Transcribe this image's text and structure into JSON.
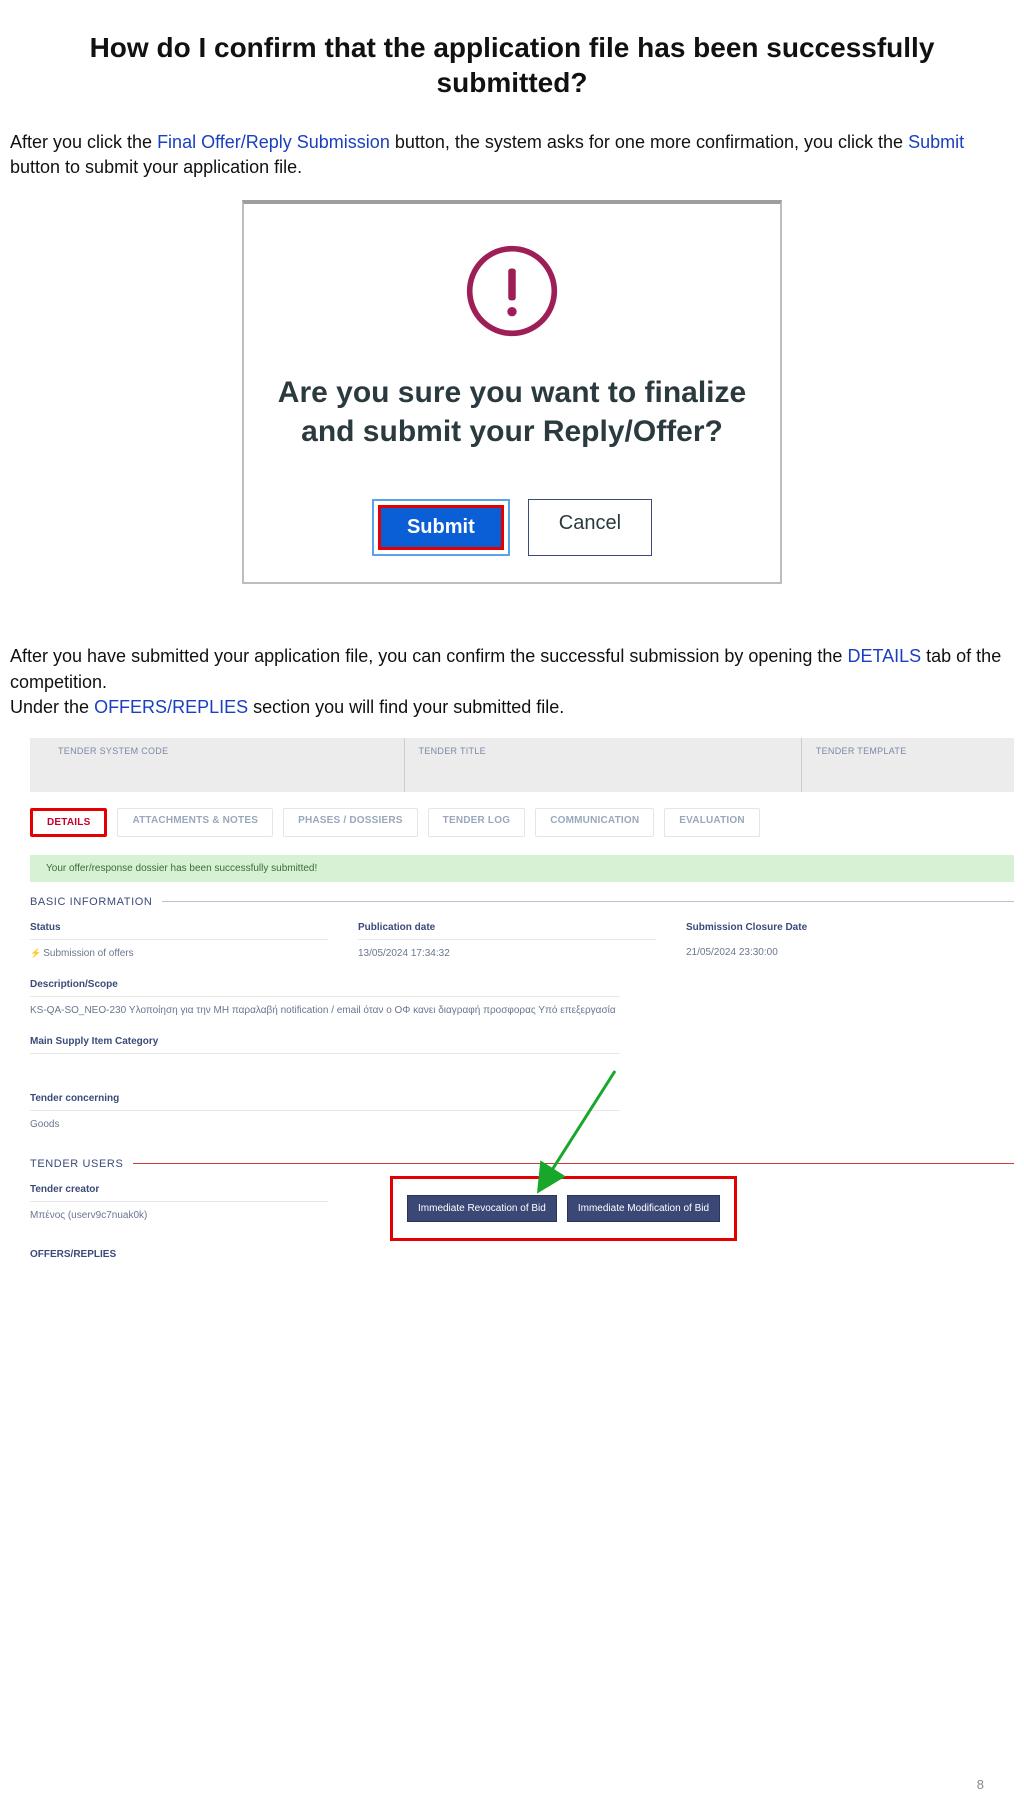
{
  "title": "How do I confirm that the application file has been successfully submitted?",
  "intro": {
    "t1": "After you click the ",
    "link1": "Final Offer/Reply Submission",
    "t2": " button, the system asks for one more confirmation, you click the ",
    "link2": "Submit",
    "t3": " button to submit your application file."
  },
  "modal": {
    "heading": "Are you sure you want to finalize and submit your Reply/Offer?",
    "submit": "Submit",
    "cancel": "Cancel"
  },
  "para2": {
    "t1": "After you have submitted your application file, you can confirm the successful submission by opening the ",
    "link1": "DETAILS",
    "t2": " tab of the competition.",
    "t3": "Under the ",
    "link2": "OFFERS/REPLIES",
    "t4": " section you will find your submitted file."
  },
  "header": {
    "c1": "TENDER SYSTEM CODE",
    "c2": "TENDER TITLE",
    "c3": "TENDER TEMPLATE"
  },
  "tabs": [
    "DETAILS",
    "ATTACHMENTS & NOTES",
    "PHASES / DOSSIERS",
    "TENDER LOG",
    "COMMUNICATION",
    "EVALUATION"
  ],
  "banner": "Your offer/response dossier has been successfully submitted!",
  "sections": {
    "basic": "BASIC INFORMATION",
    "users": "TENDER USERS",
    "offers": "OFFERS/REPLIES"
  },
  "fields": {
    "status_label": "Status",
    "status_value": "Submission of offers",
    "pub_label": "Publication date",
    "pub_value": "13/05/2024 17:34:32",
    "closure_label": "Submission Closure Date",
    "closure_value": "21/05/2024 23:30:00",
    "desc_label": "Description/Scope",
    "desc_value": "KS-QA-SO_NEO-230 Υλοποίηση για την MH παραλαβή notification / email όταν ο ΟΦ κανει διαγραφή προσφορας Υπό επεξεργασία",
    "supply_label": "Main Supply Item Category",
    "concerning_label": "Tender concerning",
    "concerning_value": "Goods",
    "creator_label": "Tender creator",
    "creator_value": "Μπένος (userv9c7nuak0k)"
  },
  "actions": {
    "revoke": "Immediate Revocation of Bid",
    "modify": "Immediate Modification of Bid"
  },
  "page_number": "8"
}
